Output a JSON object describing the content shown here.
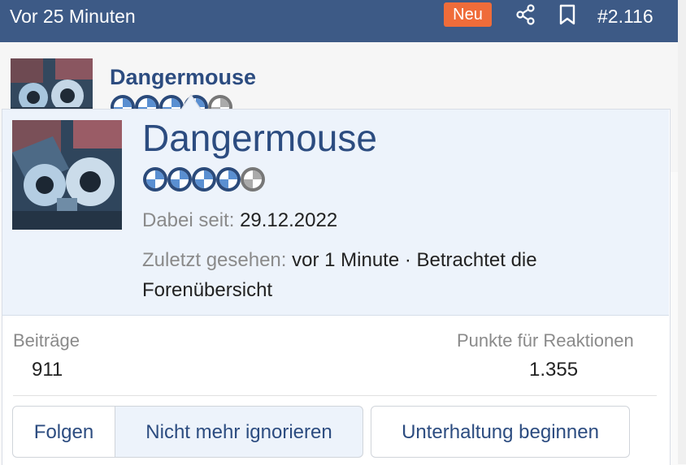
{
  "topbar": {
    "time_label": "Vor 25 Minuten",
    "badge_new": "Neu",
    "share_icon": "share-icon",
    "bookmark_icon": "bookmark-icon",
    "post_number": "#2.116"
  },
  "post": {
    "author": "Dangermouse",
    "rank_icons": 5
  },
  "profile_card": {
    "name": "Dangermouse",
    "rank_icons": 5,
    "joined_label": "Dabei seit:",
    "joined_value": "29.12.2022",
    "last_seen_label": "Zuletzt gesehen:",
    "last_seen_value": "vor 1 Minute · Betrachtet die Forenübersicht",
    "stats": {
      "posts_label": "Beiträge",
      "posts_value": "911",
      "reactions_label": "Punkte für Reaktionen",
      "reactions_value": "1.355"
    },
    "buttons": {
      "follow": "Folgen",
      "unignore": "Nicht mehr ignorieren",
      "start_conversation": "Unterhaltung beginnen"
    }
  },
  "colors": {
    "topbar_bg": "#3d5a86",
    "badge_bg": "#ef6c3a",
    "link_blue": "#2c4c80",
    "card_header_bg": "#edf3fb"
  }
}
